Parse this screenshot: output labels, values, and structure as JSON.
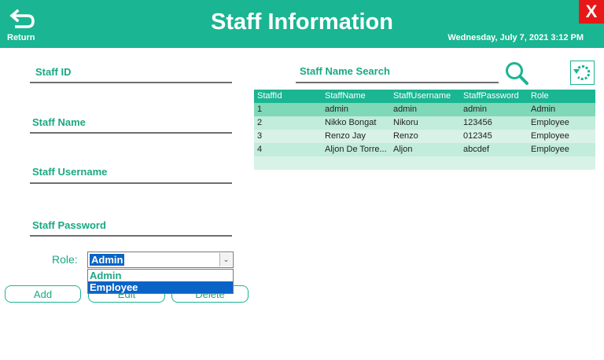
{
  "header": {
    "return_label": "Return",
    "title": "Staff Information",
    "datetime": "Wednesday, July 7, 2021 3:12 PM",
    "close_label": "X"
  },
  "form": {
    "staff_id_label": "Staff ID",
    "staff_name_label": "Staff Name",
    "staff_username_label": "Staff Username",
    "staff_password_label": "Staff Password",
    "role_label": "Role:",
    "role_value": "Admin",
    "role_options": [
      "Admin",
      "Employee"
    ]
  },
  "buttons": {
    "add": "Add",
    "edit": "Edit",
    "delete": "Delete"
  },
  "search": {
    "label": "Staff Name Search"
  },
  "table": {
    "columns": [
      "StaffId",
      "StaffName",
      "StaffUsername",
      "StaffPassword",
      "Role"
    ],
    "rows": [
      [
        "1",
        "admin",
        "admin",
        "admin",
        "Admin"
      ],
      [
        "2",
        "Nikko Bongat",
        "Nikoru",
        "123456",
        "Employee"
      ],
      [
        "3",
        "Renzo Jay",
        "Renzo",
        "012345",
        "Employee"
      ],
      [
        "4",
        "Aljon De Torre...",
        "Aljon",
        "abcdef",
        "Employee"
      ]
    ]
  },
  "colors": {
    "accent": "#1ab592",
    "close": "#e81818",
    "selection": "#0a63c6"
  },
  "icons": {
    "return": "return-arrow-icon",
    "search": "magnifier-icon",
    "refresh": "refresh-icon"
  }
}
